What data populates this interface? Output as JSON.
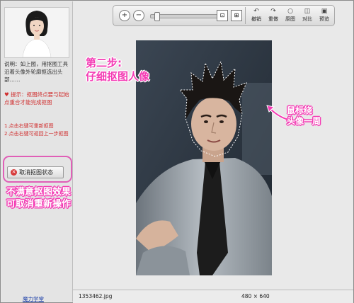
{
  "left_panel": {
    "description": "说明：如上图，用抠图工具沿着头像外轮廓抠选出头部……",
    "tip": "提示：抠图终点要与起始点重合才能完成抠图",
    "steps": [
      "1.点击右键可重新抠图",
      "2.点击右键可返回上一步抠图"
    ],
    "cancel_label": "取消抠图状态",
    "bottom_link": "魔力学堂"
  },
  "toolbar": {
    "tools": [
      {
        "label": "撤销",
        "icon": "undo-icon"
      },
      {
        "label": "重做",
        "icon": "redo-icon"
      },
      {
        "label": "原图",
        "icon": "original-icon"
      },
      {
        "label": "对比",
        "icon": "compare-icon"
      },
      {
        "label": "预览",
        "icon": "preview-icon"
      }
    ],
    "zoom_level": 0.05
  },
  "annotations": {
    "step_two": [
      "第二步:",
      "仔细抠图人像"
    ],
    "mouse_hint": [
      "鼠标绕",
      "头像一周"
    ],
    "undo_hint": [
      "不满意抠图效果",
      "可取消重新操作"
    ]
  },
  "status_bar": {
    "file_name": "1353462.jpg",
    "dimensions": "480 × 640"
  },
  "colors": {
    "accent": "#f43bb4",
    "cancel_icon": "#d73a3a"
  }
}
